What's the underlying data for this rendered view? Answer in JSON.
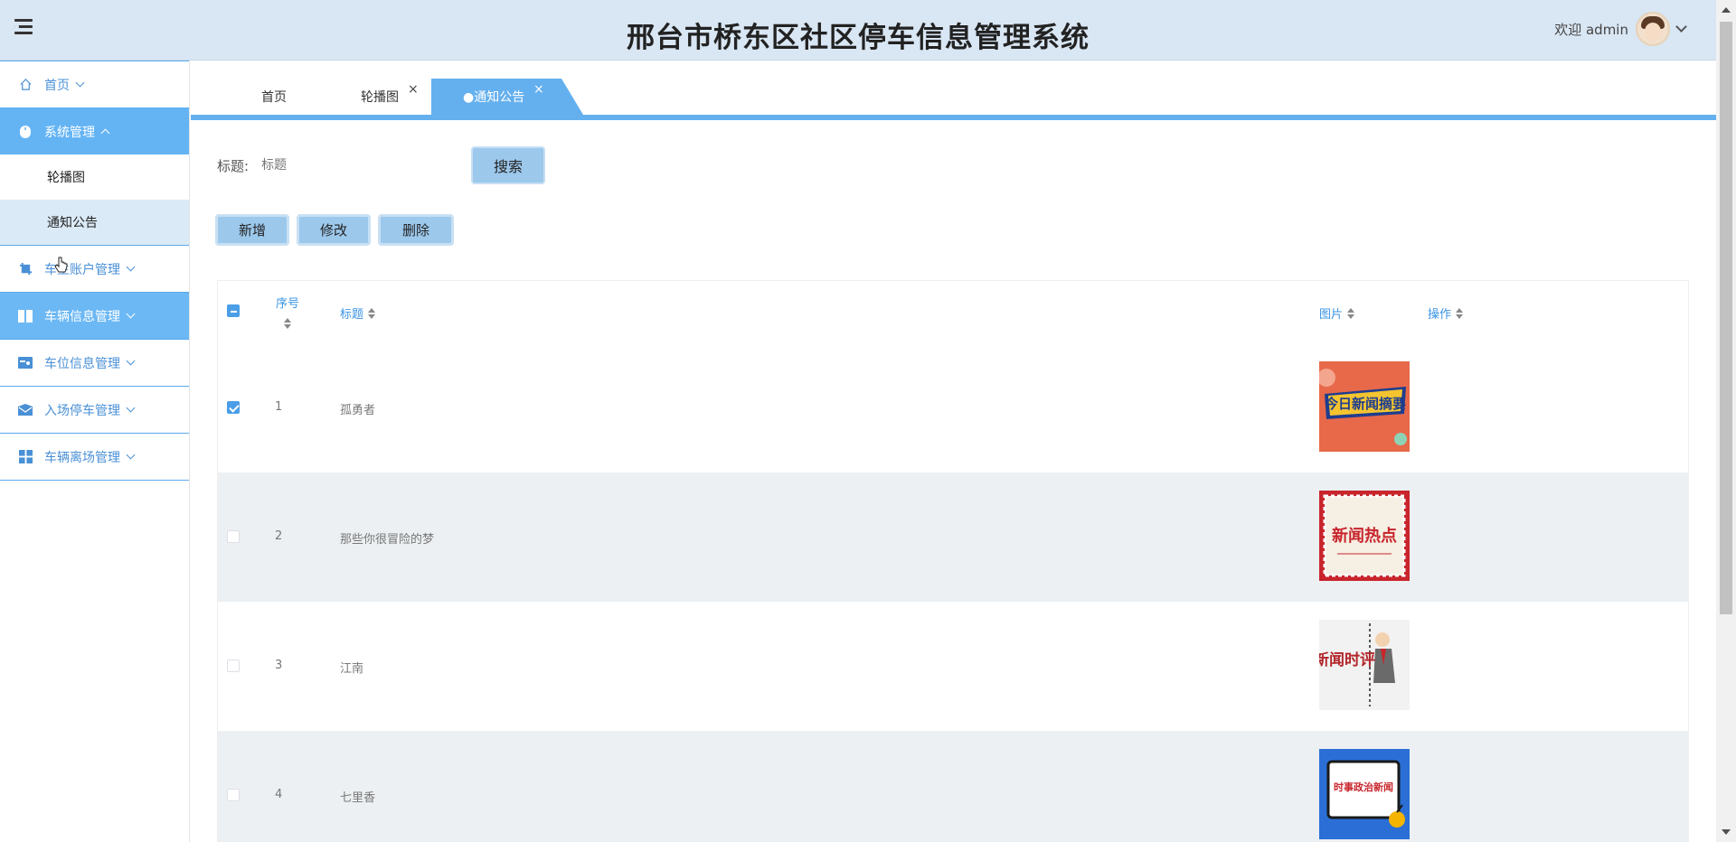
{
  "header": {
    "title": "邢台市桥东区社区停车信息管理系统",
    "welcome": "欢迎 admin",
    "bg_color": "#d9e6f3"
  },
  "sidebar": {
    "items": [
      {
        "label": "首页",
        "icon": "home-icon",
        "state": "default"
      },
      {
        "label": "系统管理",
        "icon": "mouse-icon",
        "state": "active-expanded"
      },
      {
        "label": "车主账户管理",
        "icon": "crop-icon",
        "state": "default"
      },
      {
        "label": "车辆信息管理",
        "icon": "book-icon",
        "state": "tinted"
      },
      {
        "label": "车位信息管理",
        "icon": "card-icon",
        "state": "default"
      },
      {
        "label": "入场停车管理",
        "icon": "mail-icon",
        "state": "default"
      },
      {
        "label": "车辆离场管理",
        "icon": "grid-icon",
        "state": "default"
      }
    ],
    "sub_items": [
      "轮播图",
      "通知公告"
    ],
    "accent": "#64b4f4"
  },
  "tabs": [
    {
      "label": "首页",
      "closable": false
    },
    {
      "label": "轮播图",
      "closable": true
    },
    {
      "label": "●通知公告",
      "closable": true,
      "active": true
    }
  ],
  "close_glyph": "×",
  "search": {
    "label": "标题:",
    "placeholder": "标题",
    "button": "搜索"
  },
  "toolbar": {
    "add": "新增",
    "edit": "修改",
    "delete": "删除"
  },
  "table": {
    "columns": [
      "序号",
      "标题",
      "图片",
      "操作"
    ],
    "rows": [
      {
        "index": "1",
        "title": "孤勇者",
        "checked": true,
        "image": "news-digest-thumbnail"
      },
      {
        "index": "2",
        "title": "那些你很冒险的梦",
        "checked": false,
        "image": "hot-news-thumbnail"
      },
      {
        "index": "3",
        "title": "江南",
        "checked": false,
        "image": "news-commentary-thumbnail"
      },
      {
        "index": "4",
        "title": "七里香",
        "checked": false,
        "image": "politics-news-thumbnail"
      }
    ],
    "thumb_texts": [
      "今日新闻摘要",
      "新闻热点",
      "新闻时评",
      "时事政治新闻"
    ]
  }
}
